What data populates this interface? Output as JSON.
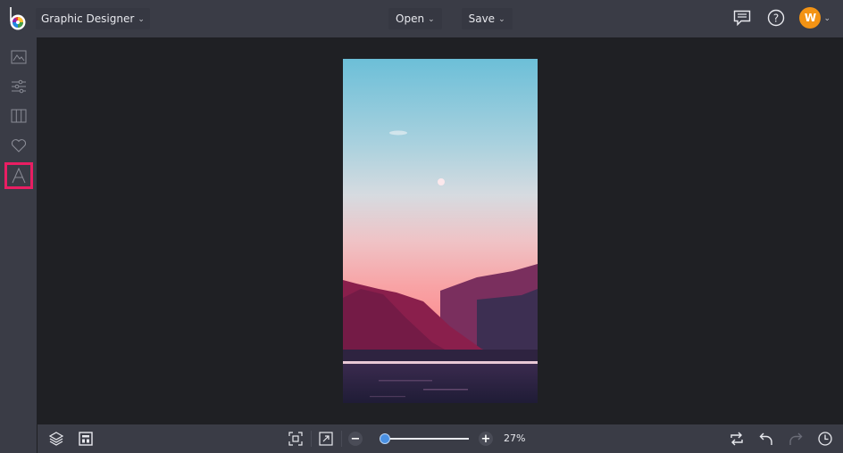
{
  "header": {
    "project_label": "Graphic Designer",
    "menus": [
      {
        "label": "Open"
      },
      {
        "label": "Save"
      }
    ],
    "icons": [
      "comments-icon",
      "help-icon"
    ],
    "user_initial": "W"
  },
  "sidebar": {
    "items": [
      {
        "name": "photos",
        "icon": "image-icon",
        "active": false
      },
      {
        "name": "edit",
        "icon": "sliders-icon",
        "active": false
      },
      {
        "name": "frames",
        "icon": "columns-icon",
        "active": false
      },
      {
        "name": "graphics",
        "icon": "heart-icon",
        "active": false
      },
      {
        "name": "text",
        "icon": "text-icon",
        "active": true
      }
    ]
  },
  "canvas": {
    "image_description": "Sunset sky gradient from blue to pink over magenta mountains and a lake"
  },
  "footer": {
    "zoom_level_percent": 27,
    "zoom_label": "27%",
    "colors": {
      "accent": "#4a90e2",
      "highlight": "#e91e63",
      "avatar": "#f39314"
    }
  }
}
